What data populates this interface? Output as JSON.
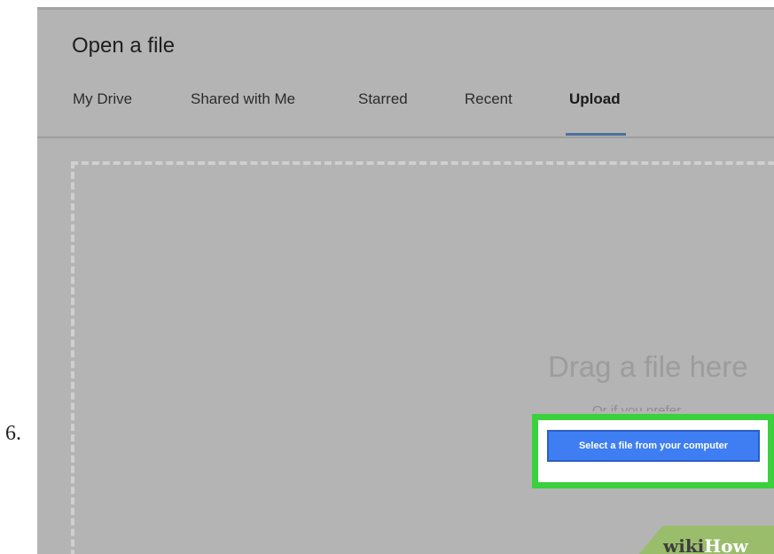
{
  "step": {
    "number": "6."
  },
  "dialog": {
    "title": "Open a file",
    "tabs": [
      {
        "label": "My Drive"
      },
      {
        "label": "Shared with Me"
      },
      {
        "label": "Starred"
      },
      {
        "label": "Recent"
      },
      {
        "label": "Upload"
      }
    ],
    "active_tab": "Upload",
    "upload": {
      "drop_text": "Drag a file here",
      "or_text": "Or if you prefer",
      "select_button_label": "Select a file from your computer"
    }
  },
  "watermark": {
    "wiki": "wiki",
    "how": "How"
  },
  "colors": {
    "dialog_background": "#b4b4b4",
    "active_tab_indicator": "#4d6f9c",
    "button_blue": "#3f7ef2",
    "highlight_green": "#39d13c",
    "watermark_green": "#9abd6c"
  }
}
